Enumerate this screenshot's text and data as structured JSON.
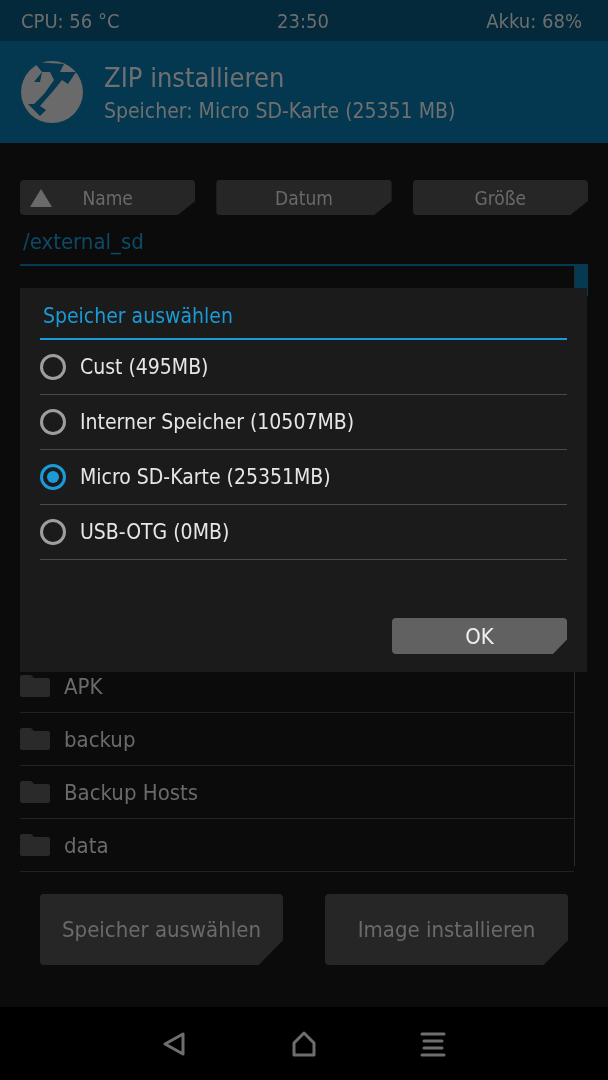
{
  "status_bar": {
    "cpu": "CPU: 56 °C",
    "time": "23:50",
    "battery": "Akku: 68%"
  },
  "header": {
    "title": "ZIP installieren",
    "subtitle": "Speicher: Micro SD-Karte (25351 MB)"
  },
  "sort_buttons": [
    {
      "label": "Name",
      "selected": true
    },
    {
      "label": "Datum",
      "selected": false
    },
    {
      "label": "Größe",
      "selected": false
    }
  ],
  "path": "/external_sd",
  "files": [
    {
      "name": "APK"
    },
    {
      "name": "backup"
    },
    {
      "name": "Backup Hosts"
    },
    {
      "name": "data"
    }
  ],
  "buttons": [
    "Speicher auswählen",
    "Image installieren"
  ],
  "dialog": {
    "title": "Speicher auswählen",
    "options": [
      {
        "label": "Cust (495MB)",
        "selected": false
      },
      {
        "label": "Interner Speicher (10507MB)",
        "selected": false
      },
      {
        "label": "Micro SD-Karte (25351MB)",
        "selected": true
      },
      {
        "label": "USB-OTG (0MB)",
        "selected": false
      }
    ],
    "ok": "OK"
  }
}
